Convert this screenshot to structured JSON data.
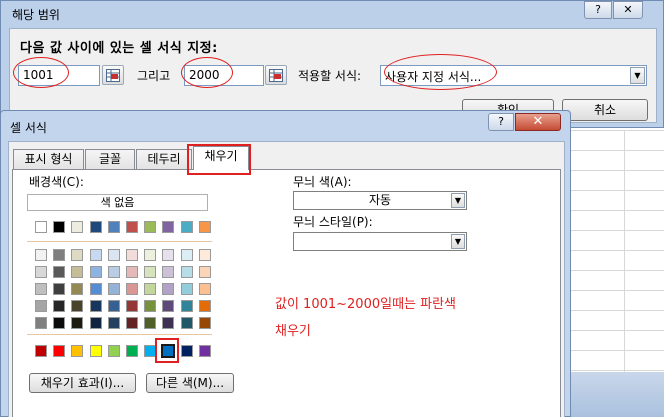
{
  "back_dialog": {
    "title": "해당 범위",
    "help_label": "?",
    "close_label": "✕",
    "rule_label": "다음 값 사이에 있는 셀 서식 지정:",
    "value1": "1001",
    "and_label": "그리고",
    "value2": "2000",
    "format_label": "적용할 서식:",
    "format_value": "사용자 지정 서식...",
    "ok_label": "확인",
    "cancel_label": "취소"
  },
  "format_dialog": {
    "title": "셀 서식",
    "help_label": "?",
    "close_label": "✕",
    "tabs": [
      {
        "label": "표시 형식"
      },
      {
        "label": "글꼴"
      },
      {
        "label": "테두리"
      },
      {
        "label": "채우기"
      }
    ],
    "active_tab": "채우기",
    "bg_color_label": "배경색(C):",
    "no_color_label": "색 없음",
    "pattern_color_label": "무늬 색(A):",
    "pattern_color_value": "자동",
    "pattern_style_label": "무늬 스타일(P):",
    "pattern_style_value": "",
    "fill_effects_label": "채우기 효과(I)...",
    "more_colors_label": "다른 색(M)...",
    "annotation_line1": "값이 1001~2000일때는 파란색",
    "annotation_line2": "채우기"
  },
  "palette": {
    "theme_row": [
      "#ffffff",
      "#000000",
      "#eeece1",
      "#1f497d",
      "#4f81bd",
      "#c0504d",
      "#9bbb59",
      "#8064a2",
      "#4bacc6",
      "#f79646"
    ],
    "tint_rows": [
      [
        "#f2f2f2",
        "#7f7f7f",
        "#ddd9c3",
        "#c6d9f0",
        "#dbe5f1",
        "#f2dcdb",
        "#ebf1dd",
        "#e5e0ec",
        "#dbeef3",
        "#fdeada"
      ],
      [
        "#d8d8d8",
        "#595959",
        "#c4bd97",
        "#8db3e2",
        "#b8cce4",
        "#e5b9b7",
        "#d7e3bc",
        "#ccc1d9",
        "#b7dde8",
        "#fbd5b5"
      ],
      [
        "#bfbfbf",
        "#3f3f3f",
        "#938953",
        "#548dd4",
        "#95b3d7",
        "#d99694",
        "#c3d69b",
        "#b2a2c7",
        "#92cddc",
        "#fac08f"
      ],
      [
        "#a5a5a5",
        "#262626",
        "#494429",
        "#17365d",
        "#366092",
        "#953734",
        "#76923c",
        "#5f497a",
        "#31859b",
        "#e36c09"
      ],
      [
        "#7f7f7f",
        "#0c0c0c",
        "#1d1b10",
        "#0f243e",
        "#244061",
        "#632423",
        "#4f6128",
        "#3f3151",
        "#205867",
        "#974806"
      ]
    ],
    "standard_row": [
      "#c00000",
      "#ff0000",
      "#ffc000",
      "#ffff00",
      "#92d050",
      "#00b050",
      "#00b0f0",
      "#0070c0",
      "#002060",
      "#7030a0"
    ],
    "selected_color": "#0070c0",
    "highlight_color": "#e02020"
  }
}
